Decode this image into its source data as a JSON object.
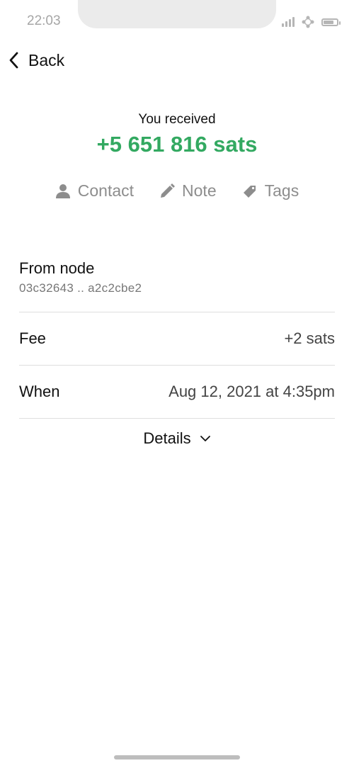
{
  "status_bar": {
    "time": "22:03",
    "icons": [
      "signal-icon",
      "network-icon",
      "battery-icon"
    ],
    "battery_level": 0.8
  },
  "nav": {
    "back_label": "Back"
  },
  "header": {
    "received_label": "You received",
    "amount": "+5 651 816 sats",
    "amount_color": "#33a961"
  },
  "actions": [
    {
      "label": "Contact",
      "icon": "person-icon"
    },
    {
      "label": "Note",
      "icon": "pencil-icon"
    },
    {
      "label": "Tags",
      "icon": "tag-icon"
    }
  ],
  "details": {
    "from_node": {
      "label": "From node",
      "value": "03c32643 .. a2c2cbe2"
    },
    "fee": {
      "label": "Fee",
      "value": "+2 sats"
    },
    "when": {
      "label": "When",
      "value": "Aug 12, 2021 at 4:35pm"
    },
    "toggle_label": "Details"
  }
}
